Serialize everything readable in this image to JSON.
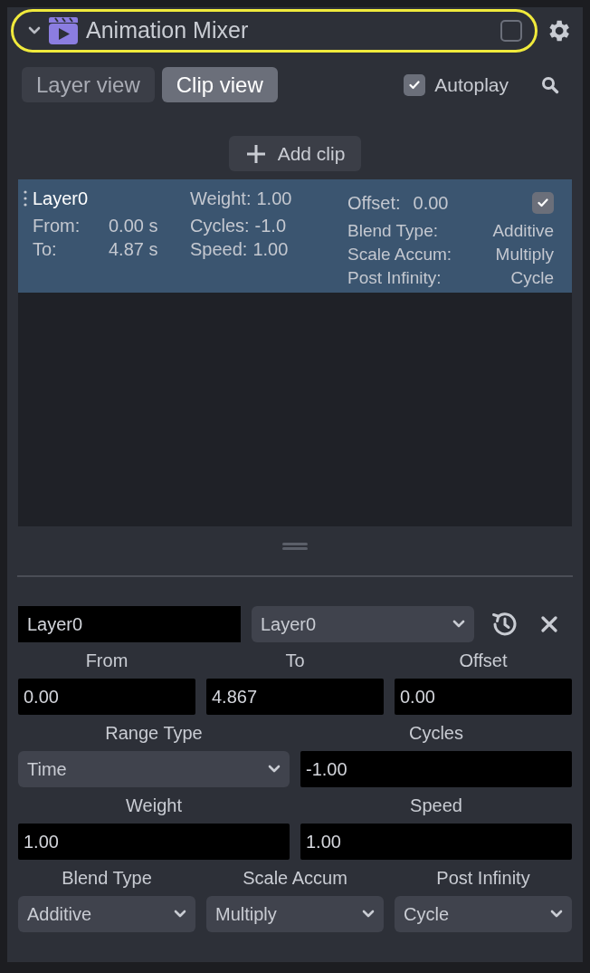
{
  "header": {
    "title": "Animation Mixer",
    "expanded": true,
    "enabled": false
  },
  "tabs": [
    {
      "label": "Layer view",
      "selected": false
    },
    {
      "label": "Clip view",
      "selected": true
    }
  ],
  "autoplay": {
    "label": "Autoplay",
    "checked": true
  },
  "add_clip": "Add clip",
  "clips": [
    {
      "name": "Layer0",
      "selected": true,
      "enabled": true,
      "left": [
        {
          "label": "From:",
          "value": "0.00 s"
        },
        {
          "label": "To:",
          "value": "4.87 s"
        }
      ],
      "middle": [
        {
          "label": "Weight:",
          "value": "1.00"
        },
        {
          "label": "Cycles:",
          "value": "-1.0"
        },
        {
          "label": "Speed:",
          "value": "1.00"
        }
      ],
      "offset": {
        "label": "Offset:",
        "value": "0.00"
      },
      "right": [
        {
          "label": "Blend Type:",
          "value": "Additive"
        },
        {
          "label": "Scale Accum:",
          "value": "Multiply"
        },
        {
          "label": "Post Infinity:",
          "value": "Cycle"
        }
      ]
    }
  ],
  "editor": {
    "name_value": "Layer0",
    "layer_select": "Layer0",
    "rows": [
      [
        {
          "label": "From",
          "value": "0.00",
          "kind": "input"
        },
        {
          "label": "To",
          "value": "4.867",
          "kind": "input"
        },
        {
          "label": "Offset",
          "value": "0.00",
          "kind": "input"
        }
      ],
      [
        {
          "label": "Range Type",
          "value": "Time",
          "kind": "select"
        },
        {
          "label": "Cycles",
          "value": "-1.00",
          "kind": "input"
        }
      ],
      [
        {
          "label": "Weight",
          "value": "1.00",
          "kind": "input"
        },
        {
          "label": "Speed",
          "value": "1.00",
          "kind": "input"
        }
      ],
      [
        {
          "label": "Blend Type",
          "value": "Additive",
          "kind": "select"
        },
        {
          "label": "Scale Accum",
          "value": "Multiply",
          "kind": "select"
        },
        {
          "label": "Post Infinity",
          "value": "Cycle",
          "kind": "select"
        }
      ]
    ]
  }
}
